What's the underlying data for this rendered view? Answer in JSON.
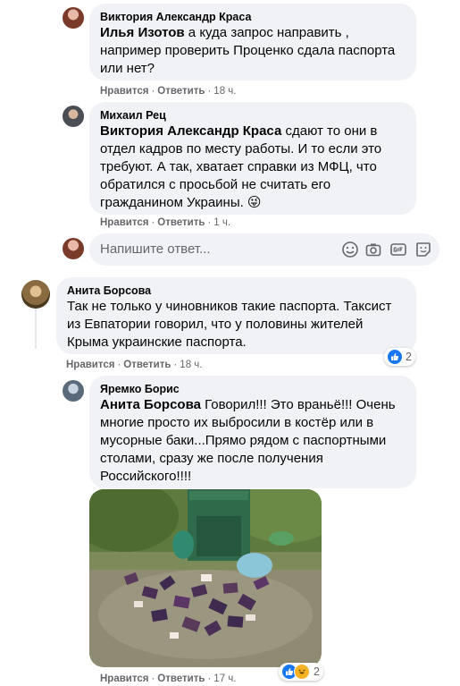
{
  "comments": [
    {
      "author": "Виктория Александр Краса",
      "mention": "Илья Изотов",
      "text": " а куда запрос направить , например проверить Проценко сдала паспорта или нет?",
      "like": "Нравится",
      "reply": "Ответить",
      "time": "18 ч."
    },
    {
      "author": "Михаил Рец",
      "mention": "Виктория Александр Краса",
      "text": " сдают то они в отдел кадров по месту работы. И то если это требуют. А так, хватает справки из МФЦ, что обратился с просьбой не считать его гражданином Украины. 😜",
      "like": "Нравится",
      "reply": "Ответить",
      "time": "1 ч."
    },
    {
      "author": "Анита Борсова",
      "mention": "",
      "text": "Так не только у чиновников такие паспорта. Таксист из Евпатории говорил, что у половины жителей Крыма украинские паспорта.",
      "like": "Нравится",
      "reply": "Ответить",
      "time": "18 ч.",
      "reactions": "2"
    },
    {
      "author": "Яремко Борис",
      "mention": "Анита Борсова",
      "text": " Говорил!!! Это враньё!!! Очень многие просто их выбросили в костёр или в мусорные баки...Прямо рядом с паспортными столами, сразу же после получения Российского!!!!",
      "like": "Нравится",
      "reply": "Ответить",
      "time": "17 ч.",
      "reactions": "2"
    }
  ],
  "reply_box": {
    "placeholder": "Напишите ответ..."
  },
  "icons": [
    "emoji-icon",
    "camera-icon",
    "gif-icon",
    "sticker-icon",
    "like-reaction-icon",
    "haha-reaction-icon"
  ],
  "colors": {
    "bubble": "#f0f2f5",
    "meta": "#65676b",
    "like_blue": "#1877f2",
    "haha_yellow": "#f7b125"
  }
}
